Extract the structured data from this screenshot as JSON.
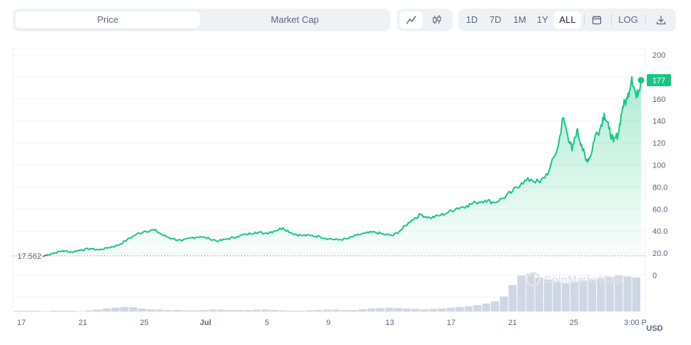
{
  "toolbar": {
    "type_options": [
      {
        "label": "Price",
        "active": true
      },
      {
        "label": "Market Cap",
        "active": false
      }
    ],
    "chart_types": [
      {
        "icon": "line-chart-icon",
        "active": true
      },
      {
        "icon": "candlestick-icon",
        "active": false
      }
    ],
    "ranges": [
      {
        "label": "1D",
        "active": false
      },
      {
        "label": "7D",
        "active": false
      },
      {
        "label": "1M",
        "active": false
      },
      {
        "label": "1Y",
        "active": false
      },
      {
        "label": "ALL",
        "active": true
      }
    ],
    "calendar_icon": "calendar-icon",
    "log_label": "LOG",
    "download_icon": "download-icon"
  },
  "chart_data": {
    "type": "area",
    "title": "",
    "xlabel": "",
    "ylabel": "",
    "currency_label": "USD",
    "watermark": "CoinMarketCap",
    "x_tick_labels": [
      "17",
      "21",
      "25",
      "Jul",
      "5",
      "9",
      "13",
      "17",
      "21",
      "25",
      "3:00 P"
    ],
    "y_tick_labels": [
      "200",
      "180",
      "160",
      "140",
      "120",
      "100",
      "80.0",
      "60.0",
      "40.0",
      "20.0",
      "0"
    ],
    "ylim": [
      0,
      200
    ],
    "start_price_label": "17.562",
    "start_price": 17.562,
    "current_price_label": "177",
    "current_price": 177,
    "colors": {
      "up": "#16c784",
      "down": "#ea3943",
      "volume": "#cfd6e4",
      "grid": "#eff2f5"
    },
    "grid": true,
    "price_series": [
      {
        "t": 0,
        "v": 17.6
      },
      {
        "t": 2,
        "v": 20
      },
      {
        "t": 4,
        "v": 22
      },
      {
        "t": 6,
        "v": 21
      },
      {
        "t": 8,
        "v": 23
      },
      {
        "t": 10,
        "v": 24
      },
      {
        "t": 12,
        "v": 23
      },
      {
        "t": 14,
        "v": 25
      },
      {
        "t": 16,
        "v": 27
      },
      {
        "t": 18,
        "v": 32
      },
      {
        "t": 20,
        "v": 37
      },
      {
        "t": 22,
        "v": 40
      },
      {
        "t": 24,
        "v": 41
      },
      {
        "t": 26,
        "v": 36
      },
      {
        "t": 28,
        "v": 33
      },
      {
        "t": 30,
        "v": 31
      },
      {
        "t": 32,
        "v": 34
      },
      {
        "t": 34,
        "v": 35
      },
      {
        "t": 36,
        "v": 33
      },
      {
        "t": 38,
        "v": 31
      },
      {
        "t": 40,
        "v": 33
      },
      {
        "t": 42,
        "v": 35
      },
      {
        "t": 44,
        "v": 37
      },
      {
        "t": 46,
        "v": 39
      },
      {
        "t": 48,
        "v": 38
      },
      {
        "t": 50,
        "v": 40
      },
      {
        "t": 52,
        "v": 43
      },
      {
        "t": 54,
        "v": 38
      },
      {
        "t": 56,
        "v": 36
      },
      {
        "t": 58,
        "v": 36
      },
      {
        "t": 60,
        "v": 35
      },
      {
        "t": 62,
        "v": 33
      },
      {
        "t": 64,
        "v": 32
      },
      {
        "t": 66,
        "v": 33
      },
      {
        "t": 68,
        "v": 36
      },
      {
        "t": 70,
        "v": 38
      },
      {
        "t": 72,
        "v": 39
      },
      {
        "t": 74,
        "v": 37
      },
      {
        "t": 76,
        "v": 36
      },
      {
        "t": 78,
        "v": 42
      },
      {
        "t": 80,
        "v": 50
      },
      {
        "t": 82,
        "v": 55
      },
      {
        "t": 84,
        "v": 52
      },
      {
        "t": 86,
        "v": 54
      },
      {
        "t": 88,
        "v": 57
      },
      {
        "t": 90,
        "v": 61
      },
      {
        "t": 92,
        "v": 63
      },
      {
        "t": 94,
        "v": 66
      },
      {
        "t": 96,
        "v": 68
      },
      {
        "t": 98,
        "v": 66
      },
      {
        "t": 100,
        "v": 70
      },
      {
        "t": 102,
        "v": 76
      },
      {
        "t": 104,
        "v": 84
      },
      {
        "t": 106,
        "v": 87
      },
      {
        "t": 108,
        "v": 84
      },
      {
        "t": 110,
        "v": 95
      },
      {
        "t": 112,
        "v": 118
      },
      {
        "t": 113,
        "v": 143
      },
      {
        "t": 114,
        "v": 128
      },
      {
        "t": 115,
        "v": 113
      },
      {
        "t": 116,
        "v": 132
      },
      {
        "t": 117,
        "v": 119
      },
      {
        "t": 118,
        "v": 104
      },
      {
        "t": 119,
        "v": 108
      },
      {
        "t": 120,
        "v": 127
      },
      {
        "t": 121,
        "v": 132
      },
      {
        "t": 122,
        "v": 147
      },
      {
        "t": 123,
        "v": 133
      },
      {
        "t": 124,
        "v": 121
      },
      {
        "t": 125,
        "v": 128
      },
      {
        "t": 126,
        "v": 153
      },
      {
        "t": 127,
        "v": 160
      },
      {
        "t": 128,
        "v": 180
      },
      {
        "t": 129,
        "v": 161
      },
      {
        "t": 130,
        "v": 177
      }
    ],
    "volume_series": [
      2,
      2,
      2,
      1,
      2,
      2,
      2,
      1,
      3,
      5,
      8,
      10,
      12,
      11,
      8,
      6,
      5,
      4,
      4,
      3,
      3,
      4,
      5,
      5,
      4,
      4,
      4,
      5,
      5,
      4,
      3,
      2,
      2,
      3,
      4,
      5,
      5,
      4,
      4,
      6,
      8,
      9,
      10,
      9,
      8,
      7,
      6,
      7,
      8,
      10,
      12,
      14,
      17,
      21,
      27,
      40,
      70,
      95,
      100,
      90,
      85,
      80,
      75,
      78,
      82,
      85,
      88,
      92,
      95,
      93,
      90
    ]
  }
}
